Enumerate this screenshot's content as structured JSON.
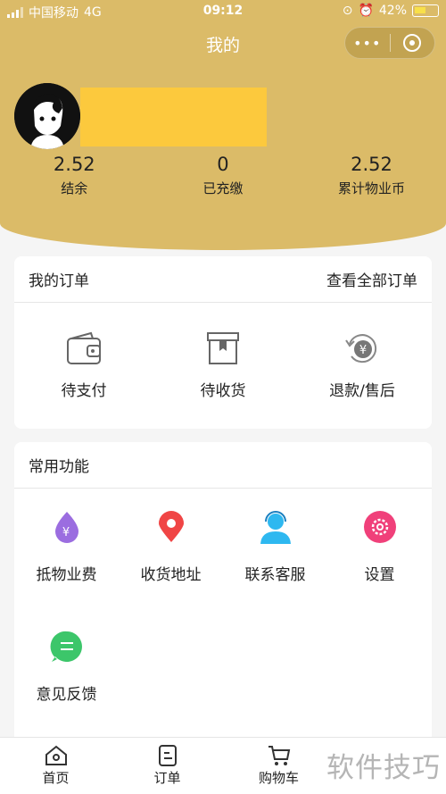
{
  "status": {
    "carrier": "中国移动",
    "network": "4G",
    "time": "09:12",
    "battery": "42%"
  },
  "nav": {
    "title": "我的",
    "more": "•••"
  },
  "stats": [
    {
      "value": "2.52",
      "label": "结余"
    },
    {
      "value": "0",
      "label": "已充缴"
    },
    {
      "value": "2.52",
      "label": "累计物业币"
    }
  ],
  "orders": {
    "title": "我的订单",
    "view_all": "查看全部订单",
    "items": [
      {
        "label": "待支付",
        "icon": "wallet-icon"
      },
      {
        "label": "待收货",
        "icon": "box-icon"
      },
      {
        "label": "退款/售后",
        "icon": "refund-icon"
      }
    ]
  },
  "functions": {
    "title": "常用功能",
    "items": [
      {
        "label": "抵物业费",
        "icon": "yuan-drop-icon",
        "color": "#9b6de0"
      },
      {
        "label": "收货地址",
        "icon": "location-pin-icon",
        "color": "#f04545"
      },
      {
        "label": "联系客服",
        "icon": "customer-service-icon",
        "color": "#2eb8f0"
      },
      {
        "label": "设置",
        "icon": "gear-icon",
        "color": "#f0407a"
      },
      {
        "label": "意见反馈",
        "icon": "feedback-chat-icon",
        "color": "#3cc66a"
      }
    ]
  },
  "tabs": [
    {
      "label": "首页",
      "icon": "home-icon"
    },
    {
      "label": "订单",
      "icon": "order-icon"
    },
    {
      "label": "购物车",
      "icon": "cart-icon"
    }
  ],
  "watermark": "软件技巧",
  "colors": {
    "header": "#dbbb68",
    "name_mask": "#fcc93d"
  }
}
